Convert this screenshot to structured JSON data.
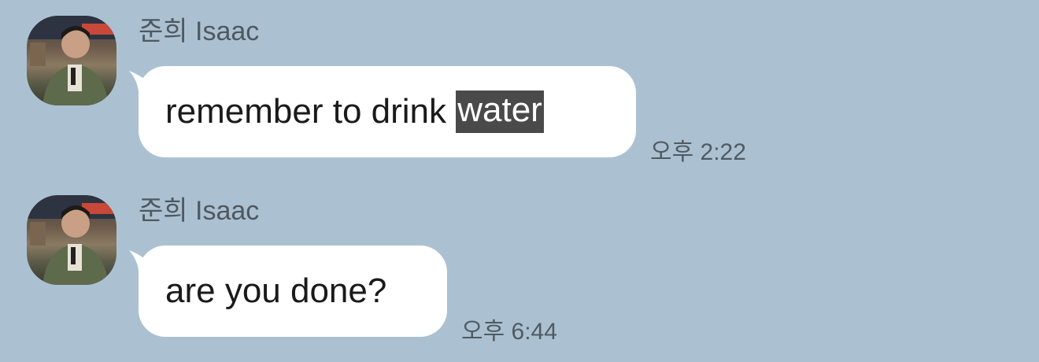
{
  "messages": [
    {
      "sender": "준희 Isaac",
      "text_before": "remember to drink ",
      "text_highlight": "water",
      "time": "오후 2:22"
    },
    {
      "sender": "준희 Isaac",
      "text_before": "are you done?",
      "text_highlight": "",
      "time": "오후 6:44"
    }
  ],
  "colors": {
    "background": "#abc1d1",
    "bubble": "#ffffff",
    "selection": "#4a4a4a",
    "meta_text": "#4f5860"
  }
}
